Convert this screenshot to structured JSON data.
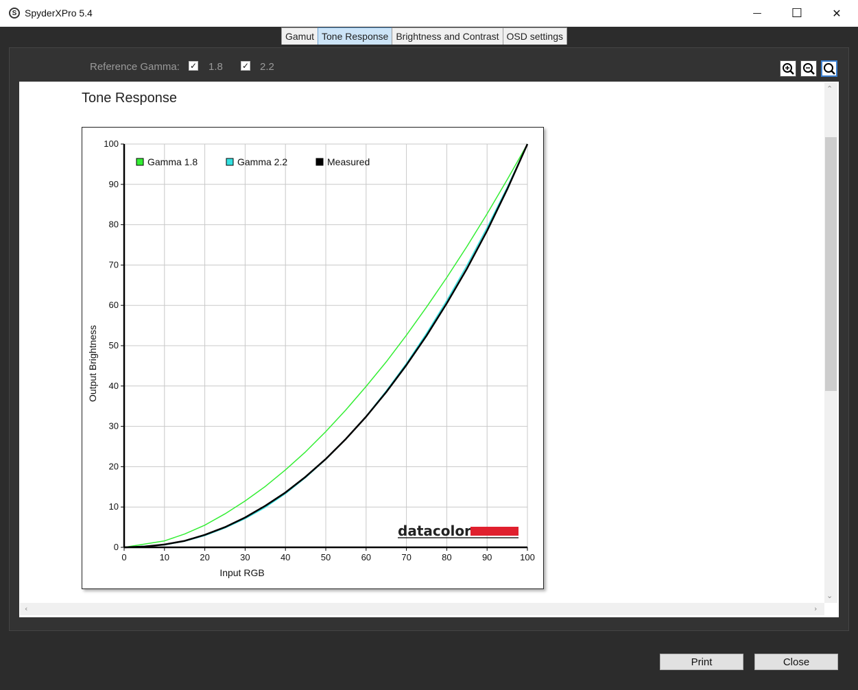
{
  "window": {
    "app_icon_letter": "S",
    "title": "SpyderXPro 5.4",
    "minimize_glyph": "—",
    "maximize_glyph": "☐",
    "close_glyph": "✕"
  },
  "tabs": [
    {
      "label": "Gamut",
      "active": false
    },
    {
      "label": "Tone Response",
      "active": true
    },
    {
      "label": "Brightness and Contrast",
      "active": false
    },
    {
      "label": "OSD settings",
      "active": false
    }
  ],
  "toolbar": {
    "reference_label": "Reference Gamma:",
    "options": [
      {
        "label": "1.8",
        "checked": true
      },
      {
        "label": "2.2",
        "checked": true
      }
    ],
    "zoom_icons": [
      "zoom-in-icon",
      "zoom-out-icon",
      "zoom-fit-icon"
    ]
  },
  "view": {
    "title": "Tone Response"
  },
  "chart_data": {
    "type": "line",
    "title": "",
    "xlabel": "Input RGB",
    "ylabel": "Output Brightness",
    "xlim": [
      0,
      100
    ],
    "ylim": [
      0,
      100
    ],
    "xticks": [
      0,
      10,
      20,
      30,
      40,
      50,
      60,
      70,
      80,
      90,
      100
    ],
    "yticks": [
      0,
      10,
      20,
      30,
      40,
      50,
      60,
      70,
      80,
      90,
      100
    ],
    "grid": true,
    "legend_position": "top-left",
    "logo_text": "datacolor",
    "series": [
      {
        "name": "Gamma 1.8",
        "color": "#33ee33",
        "x": [
          0,
          10,
          15,
          20,
          25,
          30,
          35,
          40,
          45,
          50,
          55,
          60,
          65,
          70,
          75,
          80,
          85,
          90,
          95,
          100
        ],
        "y": [
          0,
          1.6,
          3.3,
          5.5,
          8.3,
          11.5,
          15.1,
          19.2,
          23.7,
          28.7,
          34.1,
          39.9,
          46.0,
          52.6,
          59.6,
          66.9,
          74.6,
          82.7,
          91.2,
          100
        ]
      },
      {
        "name": "Gamma 2.2",
        "color": "#33e0e0",
        "x": [
          0,
          10,
          15,
          20,
          25,
          30,
          35,
          40,
          45,
          50,
          55,
          60,
          65,
          70,
          75,
          80,
          85,
          90,
          95,
          100
        ],
        "y": [
          0,
          0.6,
          1.5,
          2.9,
          4.8,
          7.1,
          9.9,
          13.3,
          17.3,
          21.8,
          26.9,
          32.5,
          38.8,
          45.6,
          53.1,
          61.2,
          69.9,
          79.3,
          89.3,
          100
        ]
      },
      {
        "name": "Measured",
        "color": "#000000",
        "x": [
          0,
          5,
          10,
          15,
          20,
          25,
          30,
          35,
          40,
          45,
          50,
          55,
          60,
          65,
          70,
          75,
          80,
          85,
          90,
          95,
          100
        ],
        "y": [
          0,
          0.2,
          0.7,
          1.6,
          3.1,
          5.0,
          7.4,
          10.3,
          13.6,
          17.5,
          21.9,
          26.9,
          32.4,
          38.5,
          45.2,
          52.5,
          60.5,
          69.1,
          78.5,
          88.8,
          100
        ]
      }
    ]
  },
  "buttons": {
    "print": "Print",
    "close": "Close"
  },
  "colors": {
    "active_tab": "#cce4f7",
    "logo_red": "#e0202e"
  }
}
